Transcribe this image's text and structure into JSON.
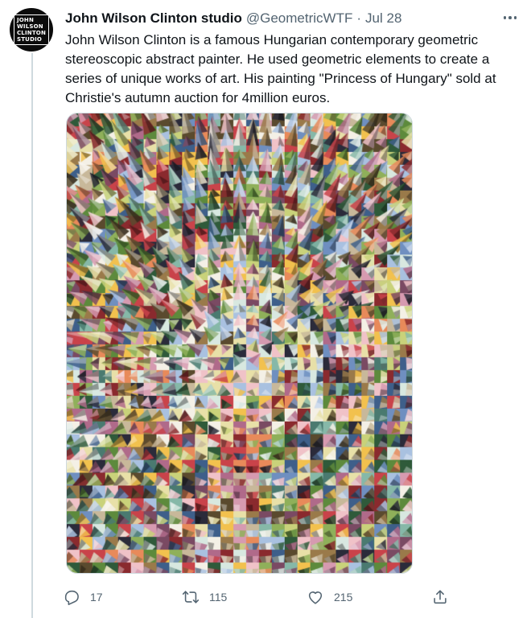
{
  "tweet": {
    "avatar_text": [
      "JOHN",
      "WILSON",
      "CLINTON",
      "STUDIO"
    ],
    "author_name": "John Wilson Clinton studio",
    "handle": "@GeometricWTF",
    "separator": "·",
    "date": "Jul 28",
    "text_lines": [
      "John Wilson Clinton is a famous Hungarian contemporary geometric",
      "stereoscopic abstract painter. He used geometric elements to create a",
      "series of unique works of art. His painting \"Princess of Hungary\" sold at",
      "Christie's autumn auction for 4million euros."
    ],
    "media": {
      "alt": "Geometric stereoscopic abstract painting"
    },
    "actions": {
      "reply_count": "17",
      "retweet_count": "115",
      "like_count": "215"
    }
  },
  "colors": {
    "text": "#0f1419",
    "secondary": "#536471",
    "border": "#cfd9de",
    "avatar_bg": "#0b0b0b"
  },
  "icons": {
    "more": "more-horizontal-icon",
    "reply": "reply-icon",
    "retweet": "retweet-icon",
    "like": "heart-icon",
    "share": "share-icon"
  }
}
